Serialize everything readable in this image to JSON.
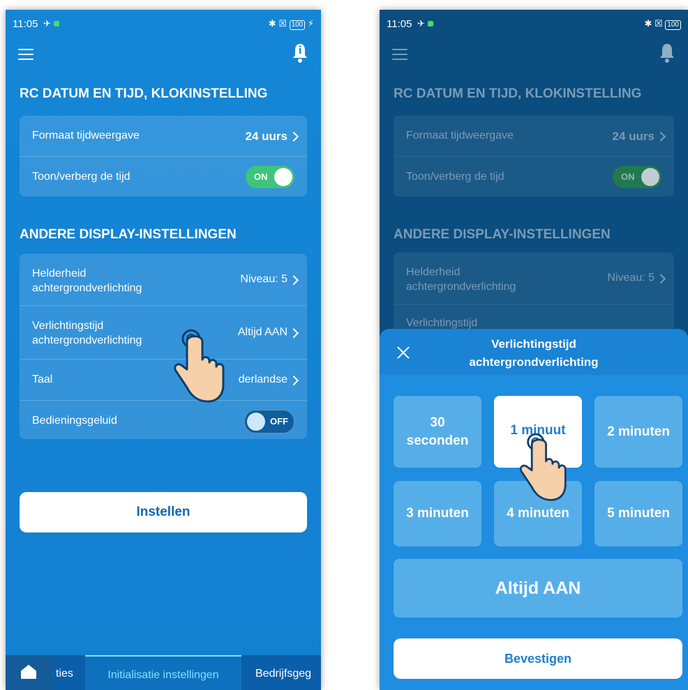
{
  "left_screen": {
    "status": {
      "time": "11:05",
      "battery": "100"
    },
    "section1_title": "RC DATUM EN TIJD, KLOKINSTELLING",
    "time_format": {
      "label": "Formaat tijdweergave",
      "value": "24 uurs"
    },
    "show_time": {
      "label": "Toon/verberg de tijd",
      "toggle": "ON"
    },
    "section2_title": "ANDERE DISPLAY-INSTELLINGEN",
    "brightness": {
      "label_line1": "Helderheid",
      "label_line2": "achtergrondverlichting",
      "value": "Niveau: 5"
    },
    "backlight_time": {
      "label_line1": "Verlichtingstijd",
      "label_line2": "achtergrondverlichting",
      "value": "Altijd AAN"
    },
    "language": {
      "label": "Taal",
      "value": "derlandse"
    },
    "operation_sound": {
      "label": "Bedieningsgeluid",
      "toggle": "OFF"
    },
    "set_button": "Instellen",
    "tabs": {
      "tab1": "ties",
      "tab2": "Initialisatie instellingen",
      "tab3": "Bedrijfsgeg"
    }
  },
  "right_screen": {
    "status": {
      "time": "11:05",
      "battery": "100"
    },
    "section1_title": "RC DATUM EN TIJD, KLOKINSTELLING",
    "time_format": {
      "label": "Formaat tijdweergave",
      "value": "24 uurs"
    },
    "show_time": {
      "label": "Toon/verberg de tijd",
      "toggle": "ON"
    },
    "section2_title": "ANDERE DISPLAY-INSTELLINGEN",
    "brightness": {
      "label_line1": "Helderheid",
      "label_line2": "achtergrondverlichting",
      "value": "Niveau: 5"
    },
    "backlight_time_partial": "Verlichtingstijd",
    "sheet": {
      "title_line1": "Verlichtingstijd",
      "title_line2": "achtergrondverlichting",
      "options": {
        "o30_line1": "30",
        "o30_line2": "seconden",
        "o1": "1 minuut",
        "o2": "2 minuten",
        "o3": "3 minuten",
        "o4": "4 minuten",
        "o5": "5 minuten",
        "always": "Altijd AAN"
      },
      "selected_option": "1 minuut",
      "confirm_button": "Bevestigen"
    }
  },
  "colors": {
    "screen_bg": "#1586d6",
    "toggle_on": "#3ec57a",
    "active_tab": "#7fe3ff",
    "sheet_bg": "#1f8de0",
    "option_bg": "#56aee8"
  }
}
